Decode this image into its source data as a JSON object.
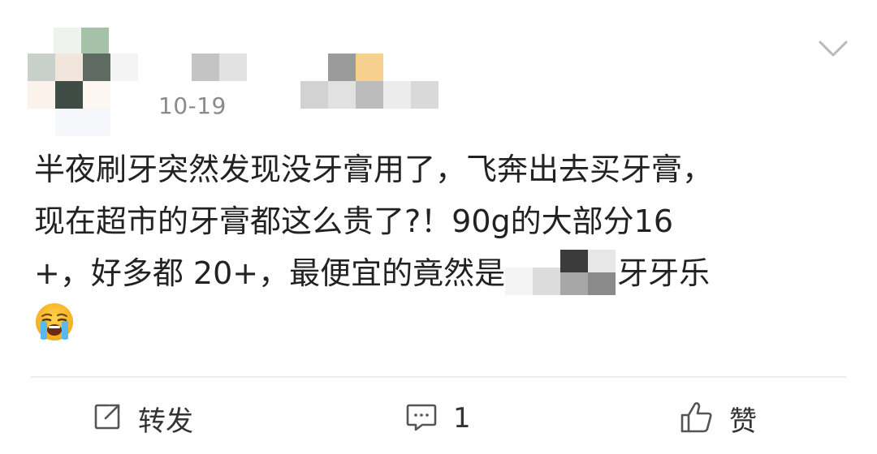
{
  "post": {
    "date": "10-19",
    "line1": "半夜刷牙突然发现没牙膏用了，飞奔出去买牙膏，",
    "line2": "现在超市的牙膏都这么贵了?！90g的大部分16",
    "line3_before": "+，好多都 20+，最便宜的竟然是",
    "line3_after": "牙牙乐",
    "emoji": "crying-face"
  },
  "actions": {
    "repost_label": "转发",
    "comment_count": "1",
    "like_label": "赞"
  },
  "icons": {
    "menu": "chevron-down-icon",
    "repost": "share-box-icon",
    "comment": "comment-bubble-icon",
    "like": "thumbs-up-icon"
  }
}
